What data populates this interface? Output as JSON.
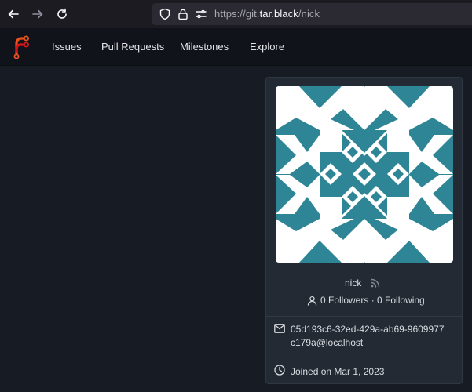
{
  "browser": {
    "url_scheme": "https://",
    "url_sub": "git.",
    "url_host": "tar.black",
    "url_path": "/nick",
    "back_icon": "arrow-left-icon",
    "forward_icon": "arrow-right-icon",
    "reload_icon": "reload-icon"
  },
  "nav": {
    "items": [
      {
        "label": "Issues"
      },
      {
        "label": "Pull Requests"
      },
      {
        "label": "Milestones"
      },
      {
        "label": "Explore"
      }
    ]
  },
  "profile": {
    "username": "nick",
    "followers_text": "0 Followers · 0 Following",
    "email": "05d193c6-32ed-429a-ab69-9609977c179a@localhost",
    "joined": "Joined on Mar 1, 2023"
  },
  "colors": {
    "page_bg": "#171c24",
    "nav_bg": "#10141a",
    "card_bg": "#232a34",
    "avatar_bg": "#2e8595",
    "avatar_fg": "#ffffff",
    "logo_accent": "#e8501c"
  }
}
